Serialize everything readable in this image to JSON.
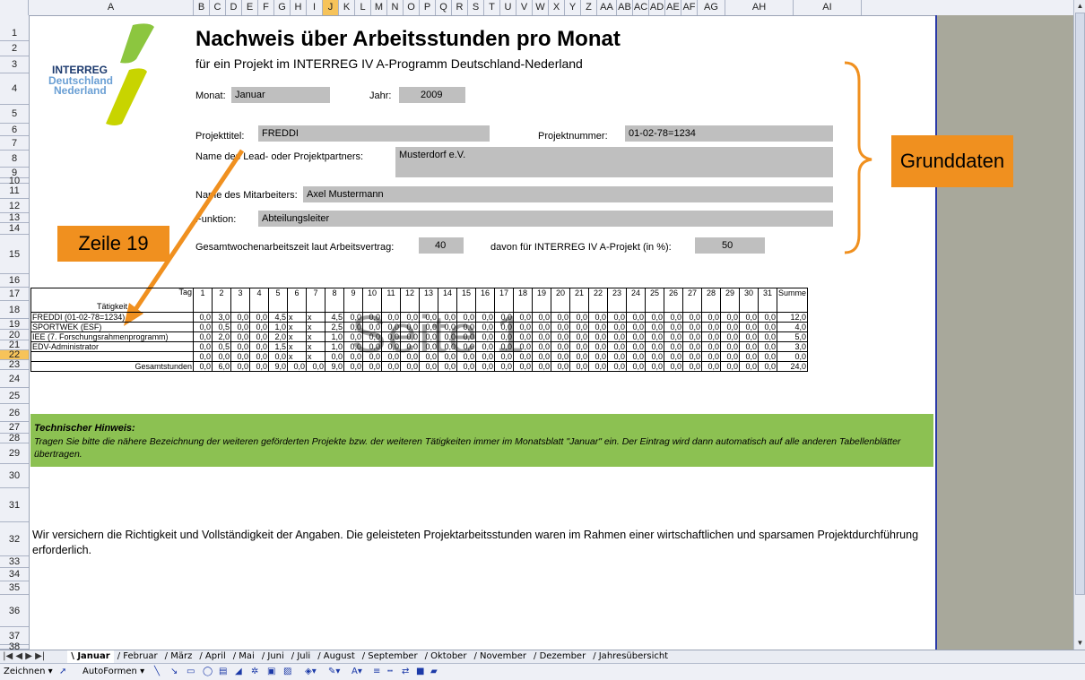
{
  "column_headers": [
    "A",
    "B",
    "C",
    "D",
    "E",
    "F",
    "G",
    "H",
    "I",
    "J",
    "K",
    "L",
    "M",
    "N",
    "O",
    "P",
    "Q",
    "R",
    "S",
    "T",
    "U",
    "V",
    "W",
    "X",
    "Y",
    "Z",
    "AA",
    "AB",
    "AC",
    "AD",
    "AE",
    "AF",
    "AG",
    "AH",
    "AI"
  ],
  "selected_column": "J",
  "row_headers": [
    "1",
    "2",
    "3",
    "4",
    "5",
    "6",
    "7",
    "8",
    "9",
    "10",
    "11",
    "12",
    "13",
    "14",
    "15",
    "16",
    "17",
    "18",
    "19",
    "20",
    "21",
    "22",
    "23",
    "24",
    "25",
    "26",
    "27",
    "28",
    "29",
    "30",
    "31",
    "32",
    "33",
    "34",
    "35",
    "36",
    "37",
    "38"
  ],
  "selected_row": "22",
  "logo": {
    "line1": "INTERREG",
    "line2": "Deutschland",
    "line3": "Nederland"
  },
  "title": "Nachweis über Arbeitsstunden pro Monat",
  "subtitle": "für ein Projekt im INTERREG IV A-Programm Deutschland-Nederland",
  "form": {
    "monat_label": "Monat:",
    "monat_value": "Januar",
    "jahr_label": "Jahr:",
    "jahr_value": "2009",
    "projekttitel_label": "Projekttitel:",
    "projekttitel_value": "FREDDI",
    "projektnummer_label": "Projektnummer:",
    "projektnummer_value": "01-02-78=1234",
    "partner_label": "Name des Lead- oder Projektpartners:",
    "partner_value": "Musterdorf e.V.",
    "mitarbeiter_label": "Name des Mitarbeiters:",
    "mitarbeiter_value": "Axel Mustermann",
    "funktion_label": "Funktion:",
    "funktion_value": "Abteilungsleiter",
    "wochenarbeitszeit_label": "Gesamtwochenarbeitszeit laut Arbeitsvertrag:",
    "wochenarbeitszeit_value": "40",
    "anteil_label": "davon für INTERREG IV A-Projekt (in %):",
    "anteil_value": "50"
  },
  "callouts": {
    "grunddaten": "Grunddaten",
    "zeile": "Zeile 19"
  },
  "watermark": "Seite 1",
  "table": {
    "tag_label": "Tag",
    "taetigkeit_label": "Tätigkeit",
    "days": [
      "1",
      "2",
      "3",
      "4",
      "5",
      "6",
      "7",
      "8",
      "9",
      "10",
      "11",
      "12",
      "13",
      "14",
      "15",
      "16",
      "17",
      "18",
      "19",
      "20",
      "21",
      "22",
      "23",
      "24",
      "25",
      "26",
      "27",
      "28",
      "29",
      "30",
      "31"
    ],
    "summe_label": "Summe",
    "rows": [
      {
        "name": "FREDDI (01-02-78=1234)",
        "cells": [
          "0,0",
          "3,0",
          "0,0",
          "0,0",
          "4,5",
          "x",
          "x",
          "4,5",
          "0,0",
          "0,0",
          "0,0",
          "0,0",
          "0,0",
          "0,0",
          "0,0",
          "0,0",
          "0,0",
          "0,0",
          "0,0",
          "0,0",
          "0,0",
          "0,0",
          "0,0",
          "0,0",
          "0,0",
          "0,0",
          "0,0",
          "0,0",
          "0,0",
          "0,0",
          "0,0"
        ],
        "sum": "12,0"
      },
      {
        "name": "SPORTWEK (ESF)",
        "cells": [
          "0,0",
          "0,5",
          "0,0",
          "0,0",
          "1,0",
          "x",
          "x",
          "2,5",
          "0,0",
          "0,0",
          "0,0",
          "0,0",
          "0,0",
          "0,0",
          "0,0",
          "0,0",
          "0,0",
          "0,0",
          "0,0",
          "0,0",
          "0,0",
          "0,0",
          "0,0",
          "0,0",
          "0,0",
          "0,0",
          "0,0",
          "0,0",
          "0,0",
          "0,0",
          "0,0"
        ],
        "sum": "4,0"
      },
      {
        "name": "IEE (7. Forschungsrahmenprogramm)",
        "cells": [
          "0,0",
          "2,0",
          "0,0",
          "0,0",
          "2,0",
          "x",
          "x",
          "1,0",
          "0,0",
          "0,0",
          "0,0",
          "0,0",
          "0,0",
          "0,0",
          "0,0",
          "0,0",
          "0,0",
          "0,0",
          "0,0",
          "0,0",
          "0,0",
          "0,0",
          "0,0",
          "0,0",
          "0,0",
          "0,0",
          "0,0",
          "0,0",
          "0,0",
          "0,0",
          "0,0"
        ],
        "sum": "5,0"
      },
      {
        "name": "EDV-Administrator",
        "cells": [
          "0,0",
          "0,5",
          "0,0",
          "0,0",
          "1,5",
          "x",
          "x",
          "1,0",
          "0,0",
          "0,0",
          "0,0",
          "0,0",
          "0,0",
          "0,0",
          "0,0",
          "0,0",
          "0,0",
          "0,0",
          "0,0",
          "0,0",
          "0,0",
          "0,0",
          "0,0",
          "0,0",
          "0,0",
          "0,0",
          "0,0",
          "0,0",
          "0,0",
          "0,0",
          "0,0"
        ],
        "sum": "3,0"
      },
      {
        "name": "",
        "cells": [
          "0,0",
          "0,0",
          "0,0",
          "0,0",
          "0,0",
          "x",
          "x",
          "0,0",
          "0,0",
          "0,0",
          "0,0",
          "0,0",
          "0,0",
          "0,0",
          "0,0",
          "0,0",
          "0,0",
          "0,0",
          "0,0",
          "0,0",
          "0,0",
          "0,0",
          "0,0",
          "0,0",
          "0,0",
          "0,0",
          "0,0",
          "0,0",
          "0,0",
          "0,0",
          "0,0"
        ],
        "sum": "0,0"
      }
    ],
    "total": {
      "name": "Gesamtstunden",
      "cells": [
        "0,0",
        "6,0",
        "0,0",
        "0,0",
        "9,0",
        "0,0",
        "0,0",
        "9,0",
        "0,0",
        "0,0",
        "0,0",
        "0,0",
        "0,0",
        "0,0",
        "0,0",
        "0,0",
        "0,0",
        "0,0",
        "0,0",
        "0,0",
        "0,0",
        "0,0",
        "0,0",
        "0,0",
        "0,0",
        "0,0",
        "0,0",
        "0,0",
        "0,0",
        "0,0",
        "0,0"
      ],
      "sum": "24,0"
    }
  },
  "hinweis": {
    "title": "Technischer Hinweis:",
    "text": "Tragen Sie bitte die nähere Bezeichnung der weiteren geförderten Projekte bzw. der weiteren Tätigkeiten immer im Monatsblatt \"Januar\" ein. Der Eintrag wird dann automatisch auf alle anderen Tabellenblätter übertragen."
  },
  "declaration": "Wir versichern die Richtigkeit und Vollständigkeit der Angaben. Die geleisteten Projektarbeitsstunden waren im Rahmen einer wirtschaftlichen und sparsamen Projektdurchführung erforderlich.",
  "sheet_tabs": [
    "Januar",
    "Februar",
    "März",
    "April",
    "Mai",
    "Juni",
    "Juli",
    "August",
    "September",
    "Oktober",
    "November",
    "Dezember",
    "Jahresübersicht"
  ],
  "active_tab": "Januar",
  "drawing_toolbar": {
    "zeichnen": "Zeichnen ▾",
    "autoformen": "AutoFormen ▾"
  },
  "colors": {
    "accent_orange": "#f0901f",
    "hint_green": "#8cc152",
    "field_gray": "#bfbfbf",
    "selected_header": "#f6c35a"
  }
}
